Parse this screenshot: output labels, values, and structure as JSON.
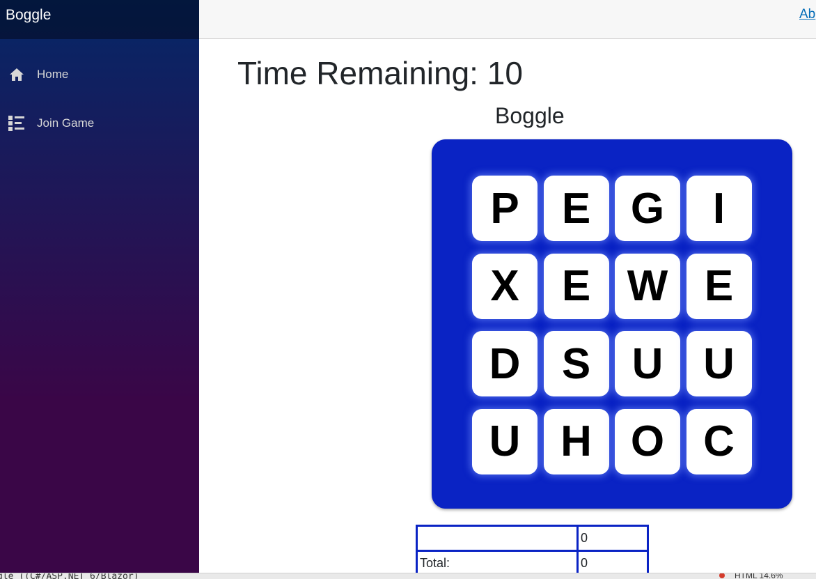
{
  "app": {
    "brand": "Boggle"
  },
  "sidebar": {
    "items": [
      {
        "label": "Home",
        "icon": "home-icon"
      },
      {
        "label": "Join Game",
        "icon": "list-icon"
      }
    ]
  },
  "top_row": {
    "about_label": "Ab"
  },
  "game": {
    "time_remaining_text": "Time Remaining: 10",
    "title": "Boggle",
    "board": [
      [
        "P",
        "E",
        "G",
        "I"
      ],
      [
        "X",
        "E",
        "W",
        "E"
      ],
      [
        "D",
        "S",
        "U",
        "U"
      ],
      [
        "U",
        "H",
        "O",
        "C"
      ]
    ],
    "board_color": "#0a23c4"
  },
  "score_table": {
    "rows": [
      [
        "",
        "0"
      ],
      [
        "Total:",
        "0"
      ]
    ]
  },
  "status_bar": {
    "left_text": "gle ((C#/ASP.NET 6/Blazor)",
    "right_text": "HTML 14.6%"
  }
}
